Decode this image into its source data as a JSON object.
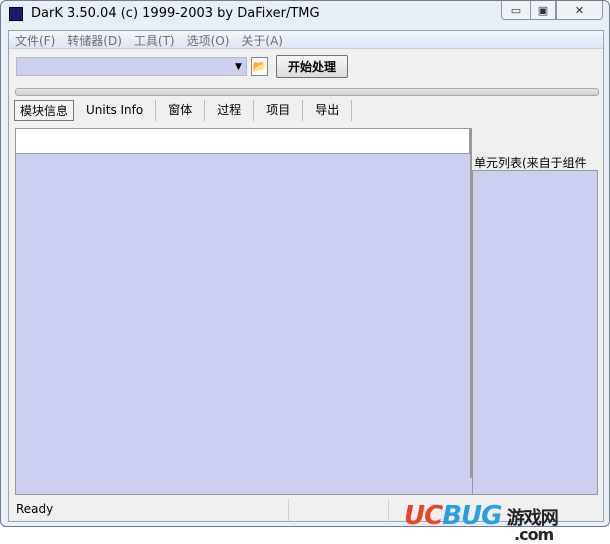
{
  "window": {
    "title": "DarK 3.50.04 (c) 1999-2003 by DaFixer/TMG",
    "minimize": "▭",
    "maximize": "▣",
    "close": "✕"
  },
  "menu": [
    "文件(F)",
    "转储器(D)",
    "工具(T)",
    "选项(O)",
    "关于(A)"
  ],
  "toolbar": {
    "combo_value": "",
    "start_label": "开始处理"
  },
  "progress": {
    "value": 0
  },
  "tabs": [
    {
      "label": "模块信息",
      "active": true
    },
    {
      "label": "Units Info"
    },
    {
      "label": "窗体"
    },
    {
      "label": "过程"
    },
    {
      "label": "项目"
    },
    {
      "label": "导出"
    }
  ],
  "right_panel": {
    "label": "单元列表(来自于组件"
  },
  "status": {
    "text": "Ready"
  },
  "watermark": {
    "text": "UCBUG游戏网 .com"
  }
}
